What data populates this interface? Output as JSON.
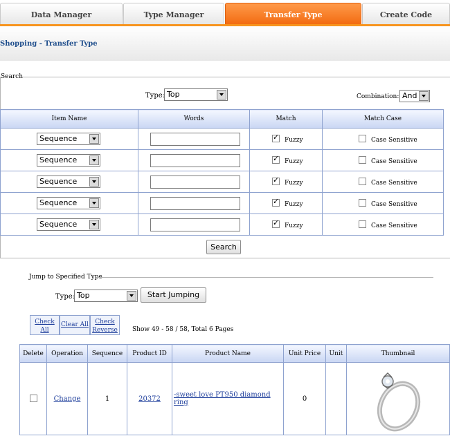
{
  "tabs": [
    {
      "label": "Data Manager",
      "active": false
    },
    {
      "label": "Type Manager",
      "active": false
    },
    {
      "label": "Transfer Type",
      "active": true
    },
    {
      "label": "Create Code",
      "active": false
    }
  ],
  "breadcrumb": "Shopping - Transfer Type",
  "search": {
    "legend": "Search",
    "type_label": "Type:",
    "type_value": "Top",
    "combination_label": "Combination:",
    "combination_value": "And",
    "columns": [
      "Item Name",
      "Words",
      "Match",
      "Match Case"
    ],
    "rows": [
      {
        "item": "Sequence",
        "words": "",
        "fuzzy": true,
        "fuzzy_label": "Fuzzy",
        "case_sensitive": false,
        "case_label": "Case Sensitive"
      },
      {
        "item": "Sequence",
        "words": "",
        "fuzzy": true,
        "fuzzy_label": "Fuzzy",
        "case_sensitive": false,
        "case_label": "Case Sensitive"
      },
      {
        "item": "Sequence",
        "words": "",
        "fuzzy": true,
        "fuzzy_label": "Fuzzy",
        "case_sensitive": false,
        "case_label": "Case Sensitive"
      },
      {
        "item": "Sequence",
        "words": "",
        "fuzzy": true,
        "fuzzy_label": "Fuzzy",
        "case_sensitive": false,
        "case_label": "Case Sensitive"
      },
      {
        "item": "Sequence",
        "words": "",
        "fuzzy": true,
        "fuzzy_label": "Fuzzy",
        "case_sensitive": false,
        "case_label": "Case Sensitive"
      }
    ],
    "button": "Search"
  },
  "jump": {
    "legend": "Jump to Specified Type",
    "type_label": "Type:",
    "type_value": "Top",
    "button": "Start Jumping"
  },
  "list_controls": {
    "check_all": "Check All",
    "clear_all": "Clear All",
    "check_reverse": "Check Reverse",
    "status": "Show 49 - 58 / 58, Total 6 Pages"
  },
  "products": {
    "columns": [
      "Delete",
      "Operation",
      "Sequence",
      "Product ID",
      "Product Name",
      "Unit Price",
      "Unit",
      "Thumbnail"
    ],
    "rows": [
      {
        "delete": false,
        "operation": "Change",
        "sequence": "1",
        "product_id": "20372",
        "product_name": "-sweet love PT950 diamond ring",
        "unit_price": "0",
        "unit": "",
        "thumbnail": "ring-thumbnail"
      }
    ]
  },
  "colors": {
    "accent": "#f7941e",
    "header_blue": "#c9d6f3",
    "link": "#1f3f9c"
  }
}
